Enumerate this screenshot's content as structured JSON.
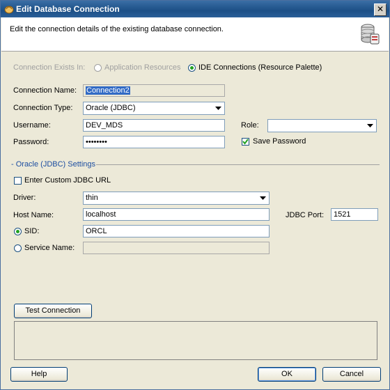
{
  "window": {
    "title": "Edit Database Connection",
    "close_glyph": "✕"
  },
  "header": {
    "description": "Edit the connection details of the existing database connection.",
    "icon": "database-icon"
  },
  "connection_exists_in": {
    "label": "Connection Exists In:",
    "options": [
      {
        "label": "Application Resources",
        "selected": false,
        "enabled": false
      },
      {
        "label": "IDE Connections (Resource Palette)",
        "selected": true,
        "enabled": true
      }
    ]
  },
  "connection_name": {
    "label": "Connection Name:",
    "value": "Connection2"
  },
  "connection_type": {
    "label": "Connection Type:",
    "value": "Oracle (JDBC)"
  },
  "username": {
    "label": "Username:",
    "value": "DEV_MDS"
  },
  "role": {
    "label": "Role:",
    "value": ""
  },
  "password": {
    "label": "Password:",
    "value": "••••••••"
  },
  "save_password": {
    "label": "Save Password",
    "checked": true
  },
  "settings_section": {
    "label": "- Oracle (JDBC) Settings"
  },
  "custom_jdbc_url": {
    "label": "Enter Custom JDBC URL",
    "checked": false
  },
  "driver": {
    "label": "Driver:",
    "value": "thin"
  },
  "host_name": {
    "label": "Host Name:",
    "value": "localhost"
  },
  "jdbc_port": {
    "label": "JDBC Port:",
    "value": "1521"
  },
  "sid": {
    "label": "SID:",
    "value": "ORCL",
    "selected": true
  },
  "service_name": {
    "label": "Service Name:",
    "value": "",
    "selected": false
  },
  "test_connection": {
    "label": "Test Connection"
  },
  "buttons": {
    "help": "Help",
    "ok": "OK",
    "cancel": "Cancel"
  }
}
